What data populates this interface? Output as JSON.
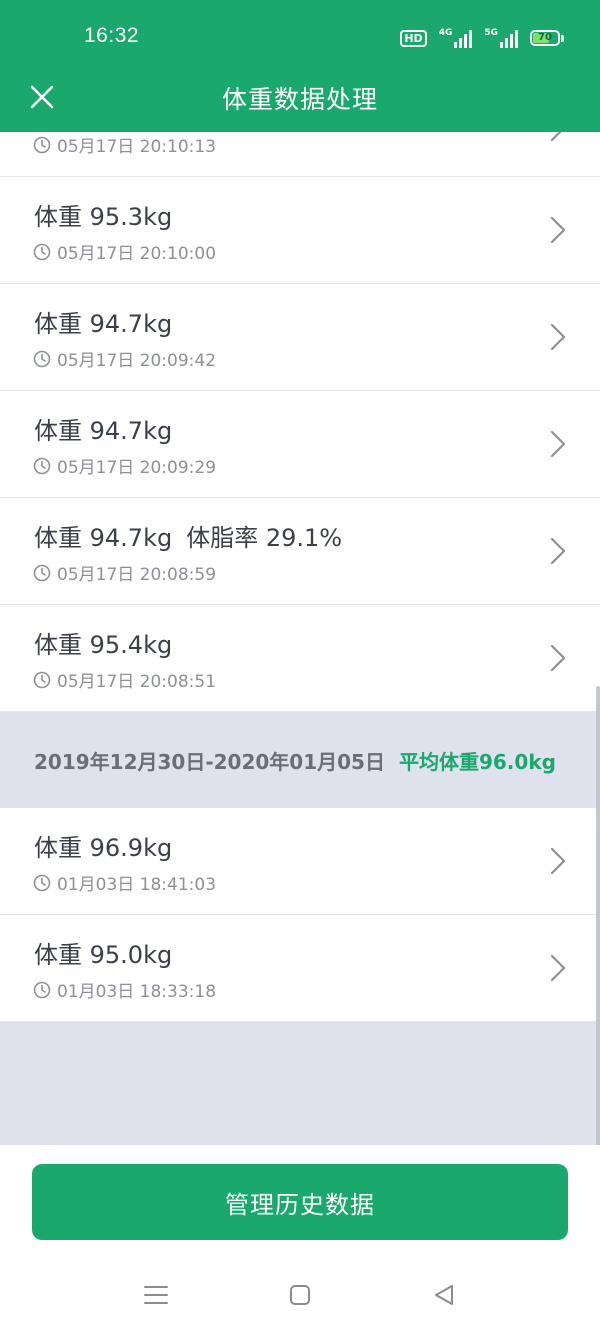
{
  "status_bar": {
    "time": "16:32",
    "hd_badge": "HD",
    "net_1": "4G",
    "net_2": "5G",
    "battery": "70",
    "battery_level_percent": 70
  },
  "header": {
    "title": "体重数据处理",
    "close_icon": "close-icon"
  },
  "records_top": [
    {
      "time": "05月17日 20:10:13"
    },
    {
      "weight": "体重 95.3kg",
      "time": "05月17日 20:10:00"
    },
    {
      "weight": "体重 94.7kg",
      "time": "05月17日 20:09:42"
    },
    {
      "weight": "体重 94.7kg",
      "time": "05月17日 20:09:29"
    },
    {
      "weight": "体重 94.7kg",
      "fat": "体脂率 29.1%",
      "time": "05月17日 20:08:59"
    },
    {
      "weight": "体重 95.4kg",
      "time": "05月17日 20:08:51"
    }
  ],
  "week_group": {
    "range": "2019年12月30日-2020年01月05日",
    "average": "平均体重96.0kg"
  },
  "records_bottom": [
    {
      "weight": "体重 96.9kg",
      "time": "01月03日 18:41:03"
    },
    {
      "weight": "体重 95.0kg",
      "time": "01月03日 18:33:18"
    }
  ],
  "footer": {
    "manage_button": "管理历史数据"
  },
  "colors": {
    "brand_green": "#1aa86d",
    "group_background": "#dfe1ec",
    "secondary_text": "#8d9097"
  },
  "icons": [
    "clock-icon",
    "chevron-right-icon",
    "menu-icon",
    "home-icon",
    "back-icon"
  ]
}
